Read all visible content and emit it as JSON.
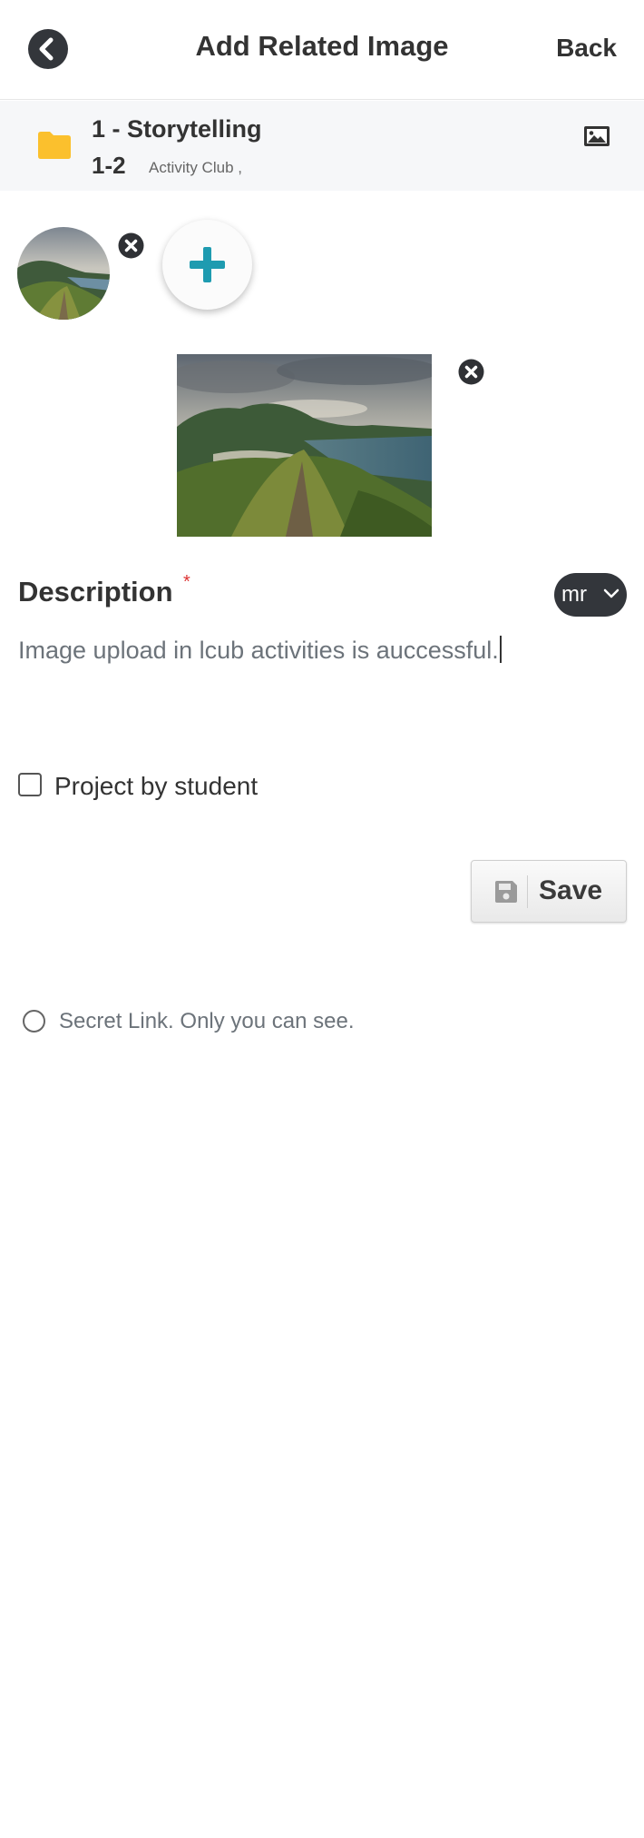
{
  "header": {
    "title": "Add Related Image",
    "back_label": "Back"
  },
  "context": {
    "title": "1 - Storytelling",
    "sub": "1-2",
    "club": "Activity Club ,"
  },
  "description": {
    "label": "Description",
    "required_mark": "*",
    "language": "mr",
    "value": "Image upload in lcub activities is auccessful."
  },
  "project_checkbox": {
    "label": "Project by student",
    "checked": false
  },
  "save": {
    "label": "Save"
  },
  "secret_link": {
    "label": "Secret Link. Only you can see.",
    "selected": false
  },
  "colors": {
    "dark_button": "#33363b",
    "folder": "#fbc02d",
    "add_plus": "#1e9bb0",
    "required": "#dd3333"
  }
}
